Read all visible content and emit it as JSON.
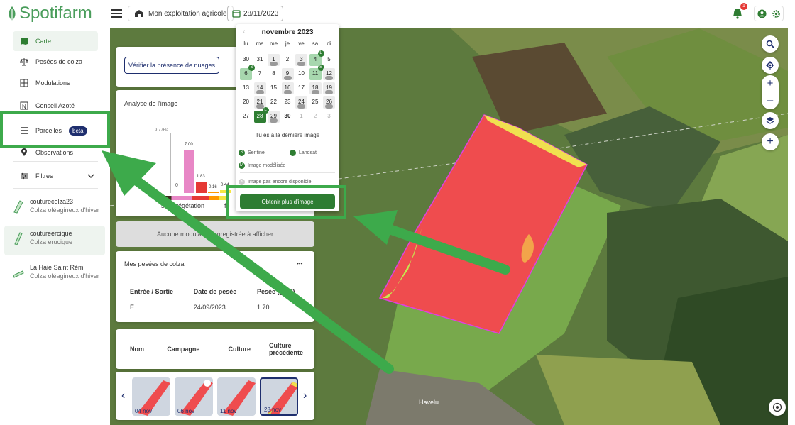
{
  "brand": {
    "name": "Spotifarm",
    "color": "#4a9d5b"
  },
  "topbar": {
    "farm_label": "Mon exploitation agricole",
    "date_label": "28/11/2023",
    "notif_count": "1"
  },
  "sidebar": {
    "items": [
      {
        "label": "Carte",
        "icon": "map-icon"
      },
      {
        "label": "Pesées de colza",
        "icon": "scale-icon"
      },
      {
        "label": "Modulations",
        "icon": "modulation-icon"
      },
      {
        "label": "Conseil Azoté",
        "icon": "nitrogen-icon"
      },
      {
        "label": "Parcelles",
        "icon": "list-icon",
        "badge": "beta"
      },
      {
        "label": "Observations",
        "icon": "pin-icon"
      },
      {
        "label": "Filtres",
        "icon": "filter-icon"
      }
    ],
    "parcels": [
      {
        "name": "couturecolza23",
        "crop": "Colza oléagineux d'hiver"
      },
      {
        "name": "coutureercique",
        "crop": "Colza erucique"
      },
      {
        "name": "La Haie Saint Rémi",
        "crop": "Colza oléagineux d'hiver"
      }
    ]
  },
  "panel": {
    "cloud_button": "Vérifier la présence de nuages",
    "analysis_title": "Analyse de l'image",
    "analysis": {
      "max_label": "9.77Ha",
      "zero_label": "0",
      "bars": [
        {
          "label": "7.00",
          "value": 7.0,
          "color": "#e887c6"
        },
        {
          "label": "1.83",
          "value": 1.83,
          "color": "#e53935"
        },
        {
          "label": "0.16",
          "value": 0.16,
          "color": "#ff9800"
        },
        {
          "label": "0.44",
          "value": 0.44,
          "color": "#f5e642"
        }
      ],
      "caption_left": "s de végétation",
      "caption_right": "fo"
    },
    "modulation_text": "Aucune modulation enregistrée à afficher",
    "weighing": {
      "title": "Mes pesées de colza",
      "more": "•••",
      "headers": [
        "Entrée / Sortie",
        "Date de pesée",
        "Pesée (g/m²)"
      ],
      "rows": [
        [
          "E",
          "24/09/2023",
          "1.70"
        ]
      ]
    },
    "crops_table": {
      "headers": [
        "Nom",
        "Campagne",
        "Culture",
        "Culture précédente"
      ]
    },
    "thumbs": [
      {
        "label": "04 nov"
      },
      {
        "label": "06 nov"
      },
      {
        "label": "11 nov"
      },
      {
        "label": "28 nov"
      }
    ]
  },
  "calendar": {
    "month": "novembre 2023",
    "dow": [
      "lu",
      "ma",
      "me",
      "je",
      "ve",
      "sa",
      "di"
    ],
    "weeks": [
      [
        {
          "d": "30"
        },
        {
          "d": "31"
        },
        {
          "d": "1",
          "c": 1
        },
        {
          "d": "2"
        },
        {
          "d": "3",
          "c": 1
        },
        {
          "d": "4",
          "a": 1,
          "b": "L"
        },
        {
          "d": "5"
        }
      ],
      [
        {
          "d": "6",
          "a": 1,
          "b": "S"
        },
        {
          "d": "7"
        },
        {
          "d": "8"
        },
        {
          "d": "9",
          "c": 1
        },
        {
          "d": "10"
        },
        {
          "d": "11",
          "a": 1,
          "b": "S"
        },
        {
          "d": "12",
          "c": 1
        }
      ],
      [
        {
          "d": "13"
        },
        {
          "d": "14",
          "c": 1
        },
        {
          "d": "15"
        },
        {
          "d": "16",
          "c": 1
        },
        {
          "d": "17"
        },
        {
          "d": "18",
          "c": 1
        },
        {
          "d": "19",
          "c": 1
        }
      ],
      [
        {
          "d": "20"
        },
        {
          "d": "21",
          "c": 1
        },
        {
          "d": "22"
        },
        {
          "d": "23"
        },
        {
          "d": "24",
          "c": 1
        },
        {
          "d": "25"
        },
        {
          "d": "26",
          "c": 1
        }
      ],
      [
        {
          "d": "27"
        },
        {
          "d": "28",
          "s": 1,
          "b": "L"
        },
        {
          "d": "29",
          "c": 1
        },
        {
          "d": "30",
          "bold": 1
        },
        {
          "d": "1",
          "m": 1
        },
        {
          "d": "2",
          "m": 1
        },
        {
          "d": "3",
          "m": 1
        }
      ]
    ],
    "last_image_text": "Tu es à la dernière image",
    "legend_sentinel": "Sentinel",
    "legend_landsat": "Landsat",
    "legend_model": "Image modélisée",
    "legend_pending": "Image pas encore disponible",
    "obtain_button": "Obtenir plus d'image"
  },
  "map": {
    "village_label": "Havelu"
  }
}
